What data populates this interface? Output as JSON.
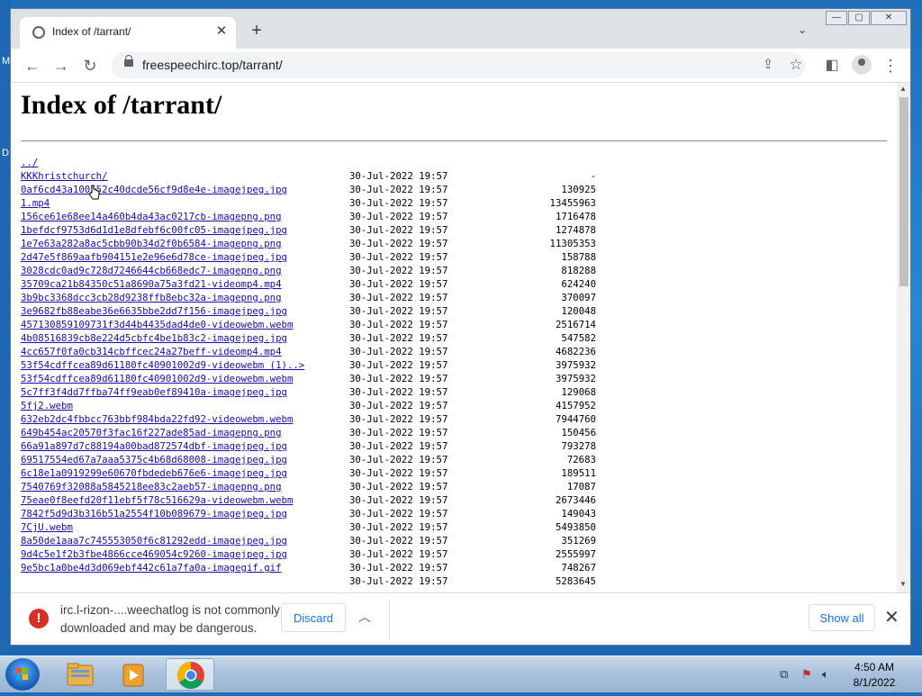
{
  "desktop": {
    "glyphs": [
      "M",
      "D"
    ]
  },
  "browser": {
    "tab_title": "Index of /tarrant/",
    "url": "freespeechirc.top/tarrant/",
    "window_controls": [
      "minimize",
      "maximize",
      "close"
    ]
  },
  "page": {
    "heading": "Index of /tarrant/",
    "entries": [
      {
        "name": "../",
        "date": "",
        "size": ""
      },
      {
        "name": "KKKhristchurch/",
        "date": "30-Jul-2022 19:57",
        "size": "-"
      },
      {
        "name": "0af6cd43a100552c40dcde56cf9d8e4e-imagejpeg.jpg",
        "date": "30-Jul-2022 19:57",
        "size": "130925"
      },
      {
        "name": "1.mp4",
        "date": "30-Jul-2022 19:57",
        "size": "13455963"
      },
      {
        "name": "156ce61e68ee14a460b4da43ac0217cb-imagepng.png",
        "date": "30-Jul-2022 19:57",
        "size": "1716478"
      },
      {
        "name": "1befdcf9753d6d1d1e8dfebf6c00fc05-imagejpeg.jpg",
        "date": "30-Jul-2022 19:57",
        "size": "1274878"
      },
      {
        "name": "1e7e63a282a8ac5cbb90b34d2f0b6584-imagepng.png",
        "date": "30-Jul-2022 19:57",
        "size": "11305353"
      },
      {
        "name": "2d47e5f869aafb904151e2e96e6d78ce-imagejpeg.jpg",
        "date": "30-Jul-2022 19:57",
        "size": "158788"
      },
      {
        "name": "3028cdc0ad9c728d7246644cb668edc7-imagepng.png",
        "date": "30-Jul-2022 19:57",
        "size": "818288"
      },
      {
        "name": "35709ca21b84350c51a8690a75a3fd21-videomp4.mp4",
        "date": "30-Jul-2022 19:57",
        "size": "624240"
      },
      {
        "name": "3b9bc3368dcc3cb28d9238ffb8ebc32a-imagepng.png",
        "date": "30-Jul-2022 19:57",
        "size": "370097"
      },
      {
        "name": "3e9682fb88eabe36e6635bbe2dd7f156-imagejpeg.jpg",
        "date": "30-Jul-2022 19:57",
        "size": "120048"
      },
      {
        "name": "457130859109731f3d44b4435dad4de0-videowebm.webm",
        "date": "30-Jul-2022 19:57",
        "size": "2516714"
      },
      {
        "name": "4b08516839cb8e224d5cbfc4be1b83c2-imagejpeg.jpg",
        "date": "30-Jul-2022 19:57",
        "size": "547582"
      },
      {
        "name": "4cc657f0fa0cb314cbffcec24a27beff-videomp4.mp4",
        "date": "30-Jul-2022 19:57",
        "size": "4682236"
      },
      {
        "name": "53f54cdffcea89d61180fc40901002d9-videowebm (1)..>",
        "date": "30-Jul-2022 19:57",
        "size": "3975932"
      },
      {
        "name": "53f54cdffcea89d61180fc40901002d9-videowebm.webm",
        "date": "30-Jul-2022 19:57",
        "size": "3975932"
      },
      {
        "name": "5c7ff3f4dd7ffba74ff9eab0ef89410a-imagejpeg.jpg",
        "date": "30-Jul-2022 19:57",
        "size": "129068"
      },
      {
        "name": "5fj2.webm",
        "date": "30-Jul-2022 19:57",
        "size": "4157952"
      },
      {
        "name": "632eb2dc4fbbcc763bbf984bda22fd92-videowebm.webm",
        "date": "30-Jul-2022 19:57",
        "size": "7944760"
      },
      {
        "name": "649b454ac20570f3fac16f227ade85ad-imagepng.png",
        "date": "30-Jul-2022 19:57",
        "size": "150456"
      },
      {
        "name": "66a91a897d7c88194a00bad872574dbf-imagejpeg.jpg",
        "date": "30-Jul-2022 19:57",
        "size": "793278"
      },
      {
        "name": "69517554ed67a7aaa5375c4b68d68008-imagejpeg.jpg",
        "date": "30-Jul-2022 19:57",
        "size": "72683"
      },
      {
        "name": "6c18e1a0919299e60670fbdedeb676e6-imagejpeg.jpg",
        "date": "30-Jul-2022 19:57",
        "size": "189511"
      },
      {
        "name": "7540769f32088a5845218ee83c2aeb57-imagepng.png",
        "date": "30-Jul-2022 19:57",
        "size": "17087"
      },
      {
        "name": "75eae0f8eefd20f11ebf5f78c516629a-videowebm.webm",
        "date": "30-Jul-2022 19:57",
        "size": "2673446"
      },
      {
        "name": "7842f5d9d3b316b51a2554f10b089679-imagejpeg.jpg",
        "date": "30-Jul-2022 19:57",
        "size": "149043"
      },
      {
        "name": "7CjU.webm",
        "date": "30-Jul-2022 19:57",
        "size": "5493850"
      },
      {
        "name": "8a50de1aaa7c745553050f6c81292edd-imagejpeg.jpg",
        "date": "30-Jul-2022 19:57",
        "size": "351269"
      },
      {
        "name": "9d4c5e1f2b3fbe4866cce469054c9260-imagejpeg.jpg",
        "date": "30-Jul-2022 19:57",
        "size": "2555997"
      },
      {
        "name": "9e5bc1a0be4d3d069ebf442c61a7fa0a-imagegif.gif",
        "date": "30-Jul-2022 19:57",
        "size": "748267"
      },
      {
        "name": "",
        "date": "30-Jul-2022 19:57",
        "size": "5283645"
      }
    ]
  },
  "download_bar": {
    "warning_icon": "!",
    "message_line1": "irc.l-rizon-....weechatlog is not commonly",
    "message_line2": "downloaded and may be dangerous.",
    "discard_label": "Discard",
    "show_all_label": "Show all"
  },
  "taskbar": {
    "apps": [
      "start-orb",
      "windows-explorer",
      "media-player",
      "google-chrome"
    ],
    "active_app": "google-chrome",
    "time": "4:50 AM",
    "date": "8/1/2022"
  }
}
